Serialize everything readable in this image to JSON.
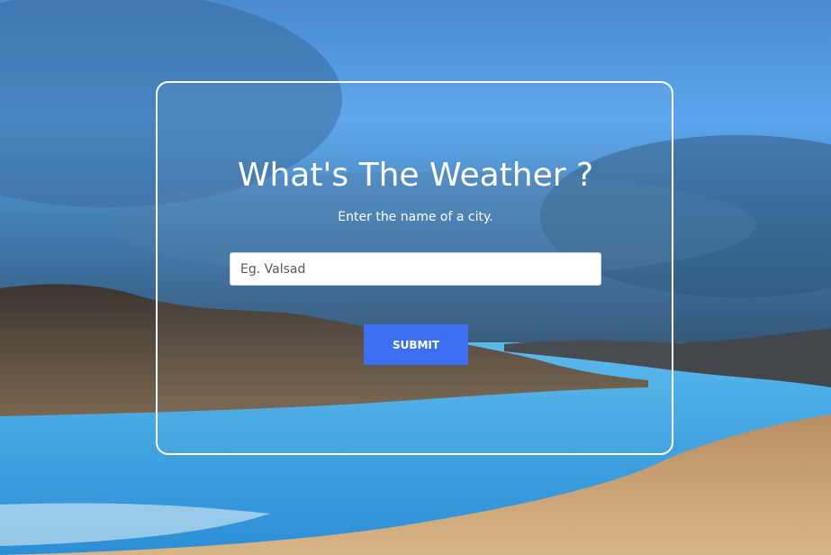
{
  "app": {
    "title": "What's The Weather ?",
    "subtitle": "Enter the name of a city."
  },
  "search": {
    "placeholder": "Eg. Valsad",
    "value": ""
  },
  "actions": {
    "submit_label": "SUBMIT"
  },
  "colors": {
    "accent": "#3c6ff1",
    "card_border": "#ffffff",
    "text": "#ffffff"
  }
}
